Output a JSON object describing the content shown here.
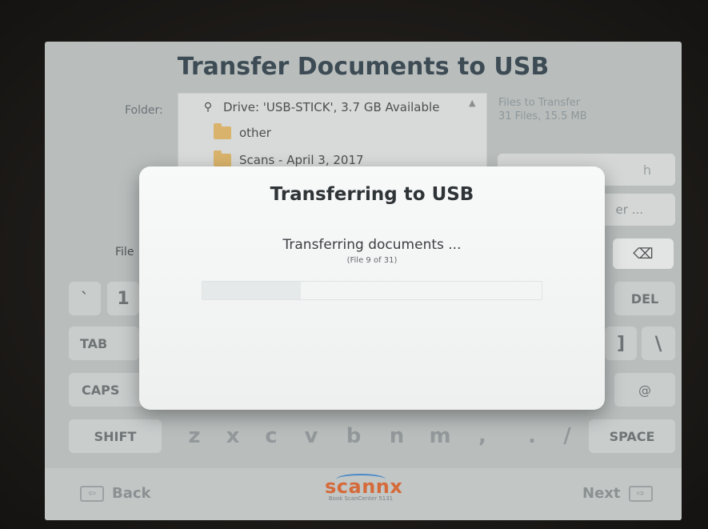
{
  "screen": {
    "title": "Transfer Documents to USB",
    "folder_label": "Folder:",
    "folders": {
      "drive": "Drive: 'USB-STICK', 3.7 GB Available",
      "other": "other",
      "scans": "Scans - April 3, 2017"
    },
    "transfer_info": {
      "line1": "Files to Transfer",
      "line2": "31 Files, 15.5 MB"
    },
    "refresh_label": "h",
    "folder_btn_label": "er ...",
    "file_label": "File",
    "backspace_symbol": "⌫"
  },
  "keyboard": {
    "row1": [
      "`",
      "1",
      "DEL"
    ],
    "row2": [
      "TAB",
      "]",
      "\\"
    ],
    "row3": [
      "CAPS",
      "@"
    ],
    "row4": [
      "SHIFT",
      "z",
      "x",
      "c",
      "v",
      "b",
      "n",
      "m",
      ",",
      ".",
      "/",
      "SPACE"
    ]
  },
  "bottom": {
    "back_label": "Back",
    "next_label": "Next",
    "logo_word": "scannx",
    "logo_sub": "Book ScanCenter 5131"
  },
  "modal": {
    "title": "Transferring to USB",
    "message": "Transferring documents ...",
    "sub_message": "(File 9 of 31)",
    "progress": 0.29
  },
  "icons": {
    "usb": "usb-icon",
    "folder": "folder-icon",
    "back": "back-arrow-icon",
    "next": "next-arrow-icon",
    "backspace": "backspace-icon"
  },
  "colors": {
    "title": "#3d4b54",
    "logo": "#d56a3a",
    "screen_bg": "#b9bebd",
    "modal_bg": "#f4f5f5"
  }
}
